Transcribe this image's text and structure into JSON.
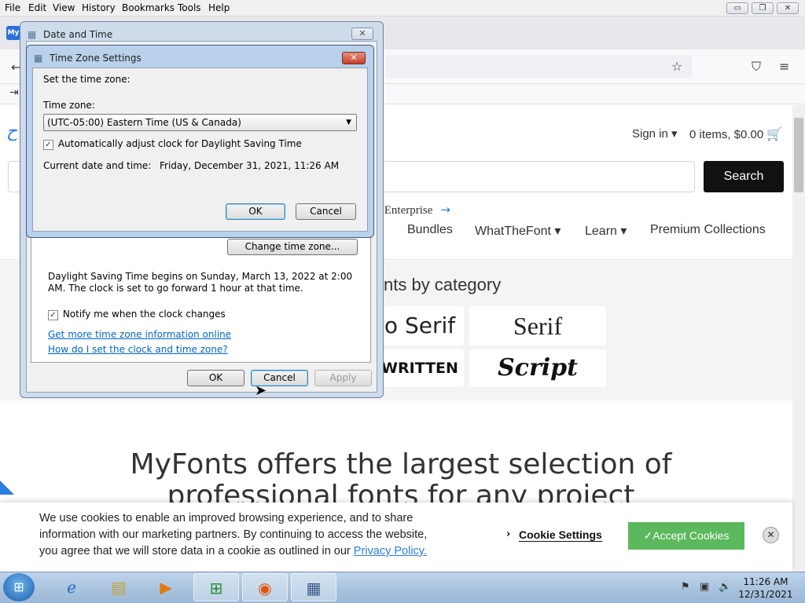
{
  "menubar": {
    "items": [
      "File",
      "Edit",
      "View",
      "History",
      "Bookmarks",
      "Tools",
      "Help"
    ]
  },
  "window_controls": {
    "minimize": "▭",
    "restore": "❐",
    "close": "✕"
  },
  "tab": {
    "favicon_text": "My"
  },
  "page": {
    "sign_in": "Sign in ▾",
    "cart": "0 items, $0.00",
    "search_button": "Search",
    "enterprise_link": "r Enterprise",
    "nav": [
      "Bundles",
      "WhatTheFont ▾",
      "Learn ▾",
      "Premium Collections"
    ],
    "category_title": "nts by category",
    "categories": [
      "o Serif",
      "Serif",
      "WRITTEN",
      "Script"
    ],
    "headline_line1": "MyFonts offers the largest selection of",
    "headline_line2": "professional fonts for any project"
  },
  "cookie_banner": {
    "text": "We use cookies to enable an improved browsing experience, and to share information with our marketing partners. By continuing to access the website, you agree that we will store data in a cookie as outlined in our ",
    "privacy_link": "Privacy Policy.",
    "settings_label": "Cookie Settings",
    "accept_label": "✓Accept Cookies"
  },
  "date_time_dialog": {
    "title": "Date and Time",
    "change_timezone_button": "Change time zone...",
    "dst_text": "Daylight Saving Time begins on Sunday, March 13, 2022 at 2:00 AM. The clock is set to go forward 1 hour at that time.",
    "notify_label": "Notify me when the clock changes",
    "link1": "Get more time zone information online",
    "link2": "How do I set the clock and time zone?",
    "ok": "OK",
    "cancel": "Cancel",
    "apply": "Apply"
  },
  "timezone_dialog": {
    "title": "Time Zone Settings",
    "set_label": "Set the time zone:",
    "timezone_label": "Time zone:",
    "timezone_value": "(UTC-05:00) Eastern Time (US & Canada)",
    "auto_dst_label": "Automatically adjust clock for Daylight Saving Time",
    "current_label": "Current date and time:",
    "current_value": "Friday, December 31, 2021, 11:26 AM",
    "ok": "OK",
    "cancel": "Cancel"
  },
  "taskbar": {
    "time": "11:26 AM",
    "date": "12/31/2021"
  }
}
